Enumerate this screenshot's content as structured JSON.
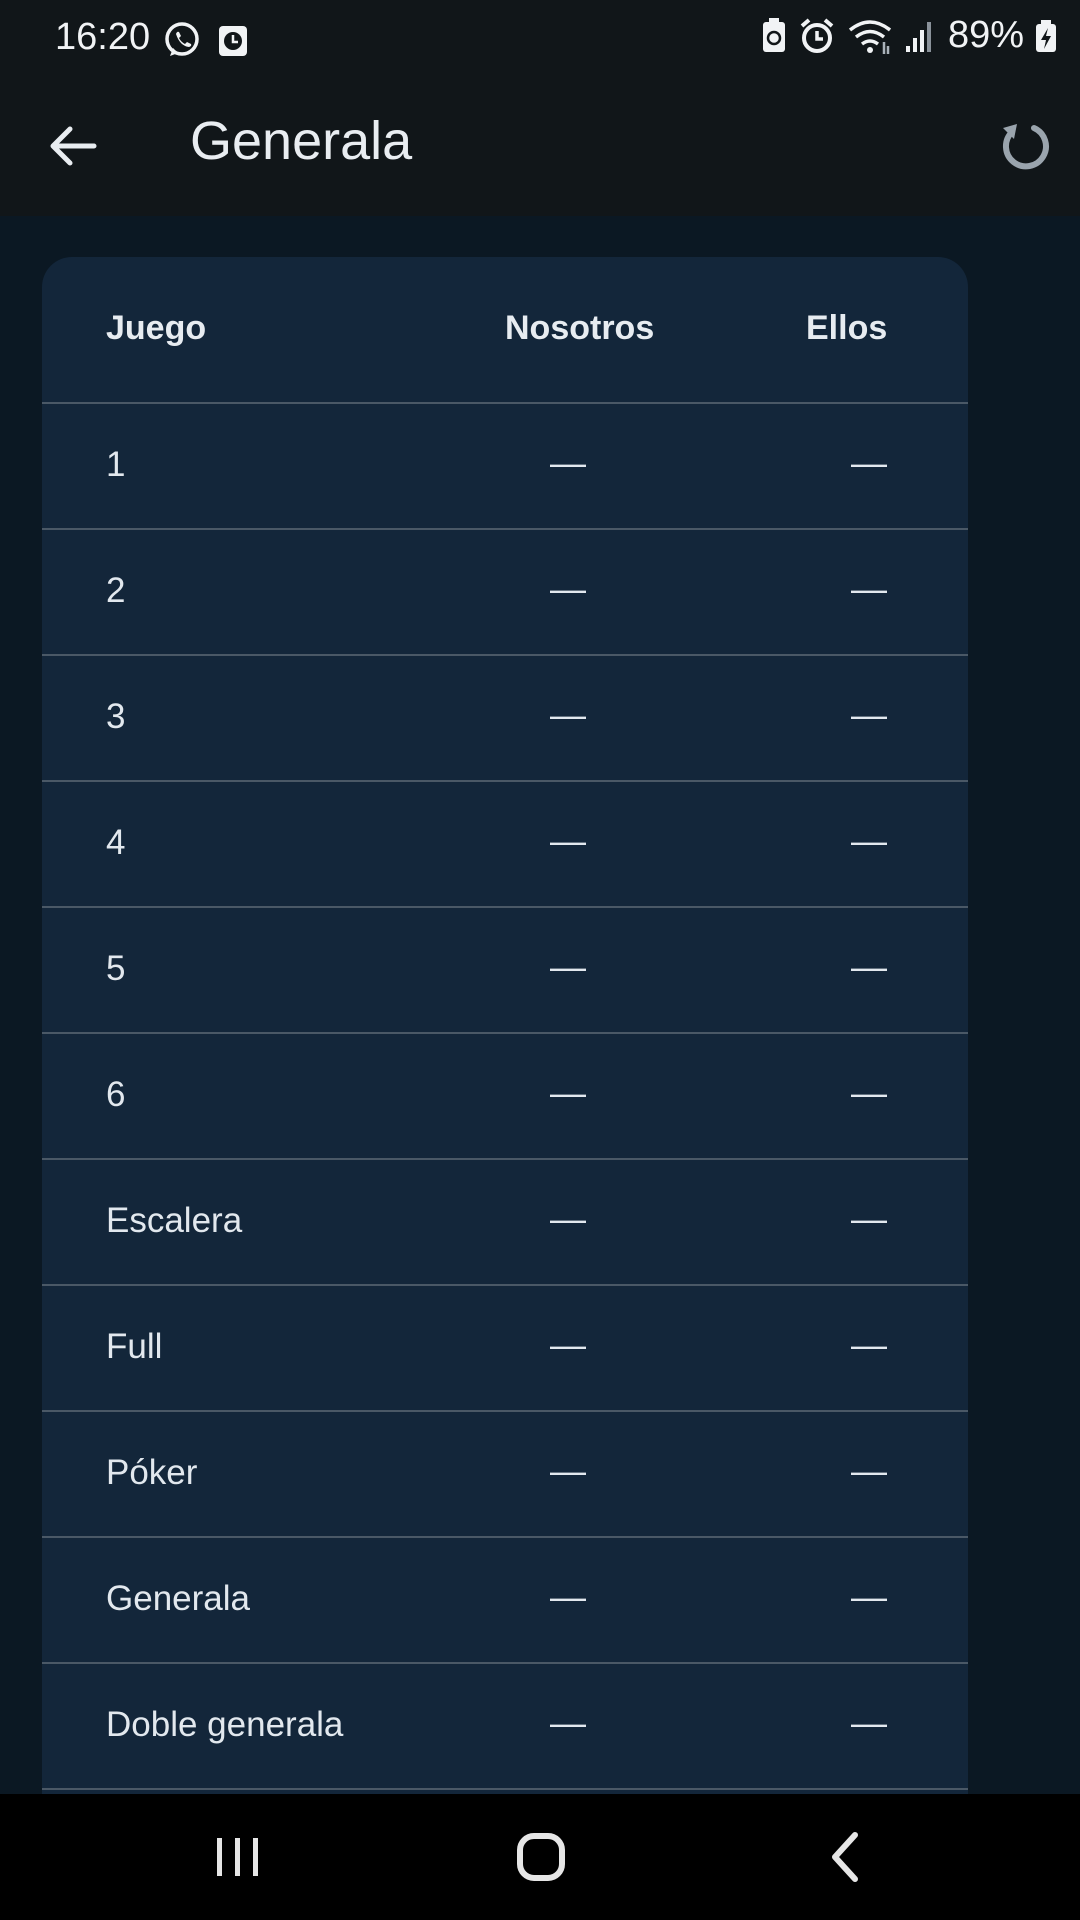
{
  "status_bar": {
    "time": "16:20",
    "battery": "89%",
    "left_icons": [
      "whatsapp-icon",
      "clock-app-icon"
    ],
    "right_icons": [
      "battery-saver-icon",
      "alarm-icon",
      "wifi-icon",
      "signal-icon",
      "battery-charging-icon"
    ]
  },
  "app_bar": {
    "title": "Generala",
    "back_icon": "arrow-back-icon",
    "action_icon": "refresh-icon"
  },
  "table": {
    "headers": {
      "game": "Juego",
      "us": "Nosotros",
      "them": "Ellos"
    },
    "rows": [
      {
        "game": "1",
        "us": "—",
        "them": "—"
      },
      {
        "game": "2",
        "us": "—",
        "them": "—"
      },
      {
        "game": "3",
        "us": "—",
        "them": "—"
      },
      {
        "game": "4",
        "us": "—",
        "them": "—"
      },
      {
        "game": "5",
        "us": "—",
        "them": "—"
      },
      {
        "game": "6",
        "us": "—",
        "them": "—"
      },
      {
        "game": "Escalera",
        "us": "—",
        "them": "—"
      },
      {
        "game": "Full",
        "us": "—",
        "them": "—"
      },
      {
        "game": "Póker",
        "us": "—",
        "them": "—"
      },
      {
        "game": "Generala",
        "us": "—",
        "them": "—"
      },
      {
        "game": "Doble generala",
        "us": "—",
        "them": "—"
      }
    ]
  },
  "nav_bar": {
    "icons": [
      "recents-icon",
      "home-icon",
      "back-icon"
    ]
  },
  "colors": {
    "app_bar_bg": "#111619",
    "page_bg": "#0b1823",
    "card_bg": "#13263a",
    "divider": "#4a5866",
    "text": "#e6ebf0"
  }
}
